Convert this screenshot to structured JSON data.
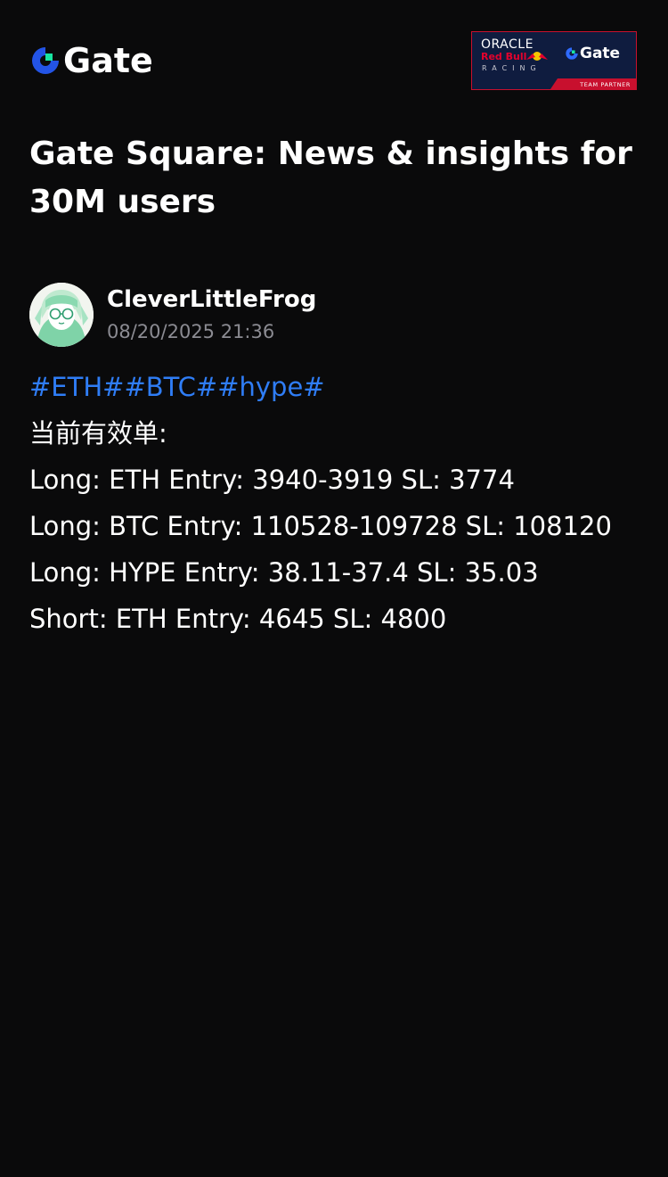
{
  "header": {
    "logo_text": "Gate",
    "logo_icon": "gate-logo-icon",
    "partner_badge": {
      "oracle_text": "ORACLE",
      "redbull_text": "Red Bull",
      "racing_text": "RACING",
      "gate_text": "Gate",
      "strip_text": "TEAM PARTNER"
    }
  },
  "page": {
    "title": "Gate Square: News & insights for 30M users"
  },
  "post": {
    "author": {
      "name": "CleverLittleFrog",
      "avatar_icon": "avatar-anime-portrait"
    },
    "timestamp": "08/20/2025 21:36",
    "tags": [
      {
        "label": "#ETH#"
      },
      {
        "label": "#BTC#"
      },
      {
        "label": "#hype#"
      }
    ],
    "lines": [
      "当前有效单:",
      "Long: ETH Entry: 3940-3919 SL: 3774",
      "Long: BTC Entry: 110528-109728 SL: 108120",
      "Long: HYPE Entry: 38.11-37.4 SL: 35.03",
      "Short: ETH Entry: 4645 SL: 4800"
    ]
  },
  "colors": {
    "background": "#0a0a0b",
    "text": "#ffffff",
    "muted": "#8b8b92",
    "tag_link": "#2f7df6",
    "brand_blue": "#2354e6",
    "brand_green": "#17e6a1",
    "badge_navy": "#0f1c3f",
    "badge_red": "#c8102e"
  }
}
